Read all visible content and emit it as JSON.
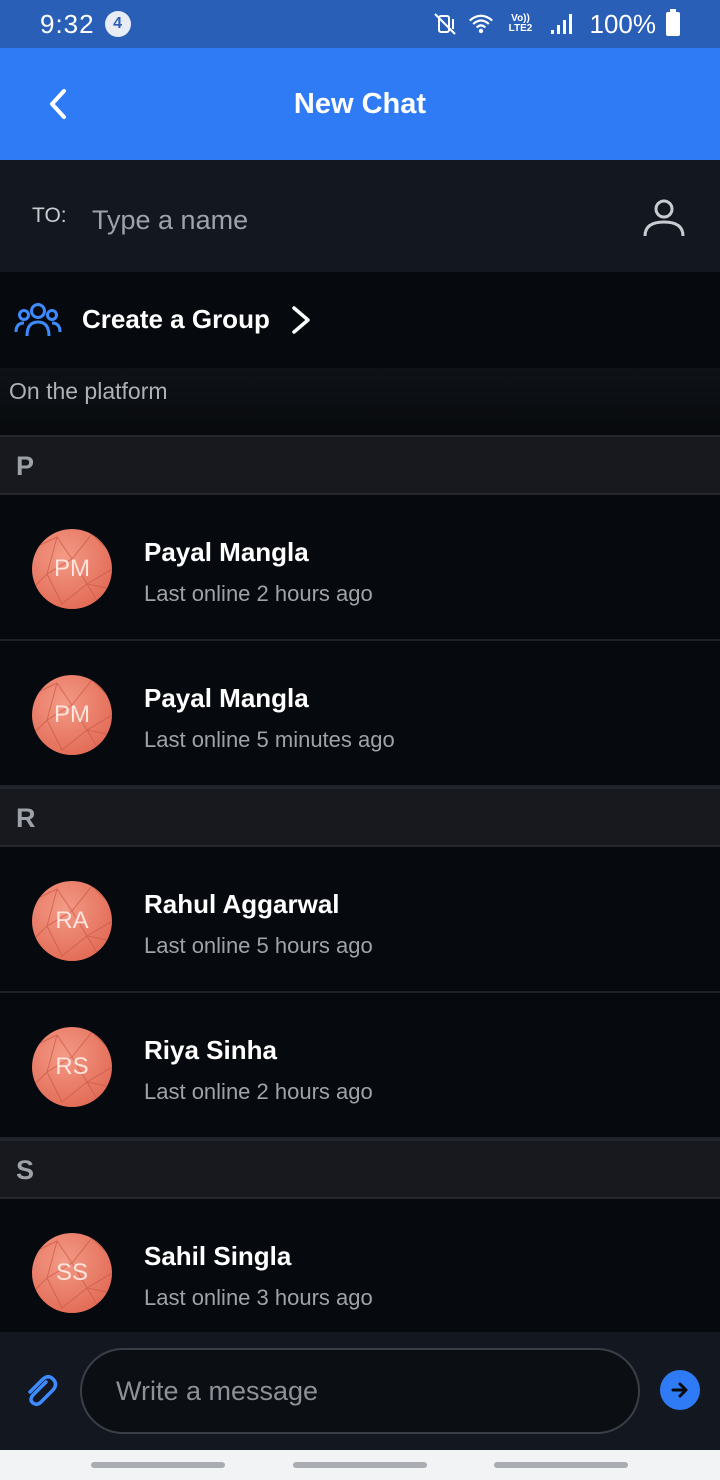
{
  "status_bar": {
    "time": "9:32",
    "notification_count": "4",
    "lte_label_top": "Vo))",
    "lte_label_bottom": "LTE2",
    "battery": "100%"
  },
  "app_bar": {
    "title": "New Chat",
    "back_icon": "chevron-left-icon"
  },
  "to_field": {
    "label": "TO:",
    "placeholder": "Type a name",
    "value": "",
    "contact_icon": "person-icon"
  },
  "create_group": {
    "label": "Create a Group",
    "icon": "group-icon",
    "chevron": "chevron-right-icon"
  },
  "platform_section": {
    "label": "On the platform"
  },
  "sections": [
    {
      "letter": "P",
      "contacts": [
        {
          "initials": "PM",
          "name": "Payal Mangla",
          "status": "Last online 2 hours ago"
        },
        {
          "initials": "PM",
          "name": "Payal Mangla",
          "status": "Last online 5 minutes ago"
        }
      ]
    },
    {
      "letter": "R",
      "contacts": [
        {
          "initials": "RA",
          "name": "Rahul Aggarwal",
          "status": "Last online 5 hours ago"
        },
        {
          "initials": "RS",
          "name": "Riya Sinha",
          "status": "Last online 2 hours ago"
        }
      ]
    },
    {
      "letter": "S",
      "contacts": [
        {
          "initials": "SS",
          "name": "Sahil Singla",
          "status": "Last online 3 hours ago"
        }
      ]
    }
  ],
  "composer": {
    "placeholder": "Write a message",
    "value": "",
    "attach_icon": "paperclip-icon",
    "send_icon": "arrow-right-icon"
  },
  "colors": {
    "status_bar": "#2a5fb8",
    "app_bar": "#2f7bf5",
    "background": "#06090d",
    "avatar": "#e4705b",
    "accent": "#2f7bf5"
  }
}
